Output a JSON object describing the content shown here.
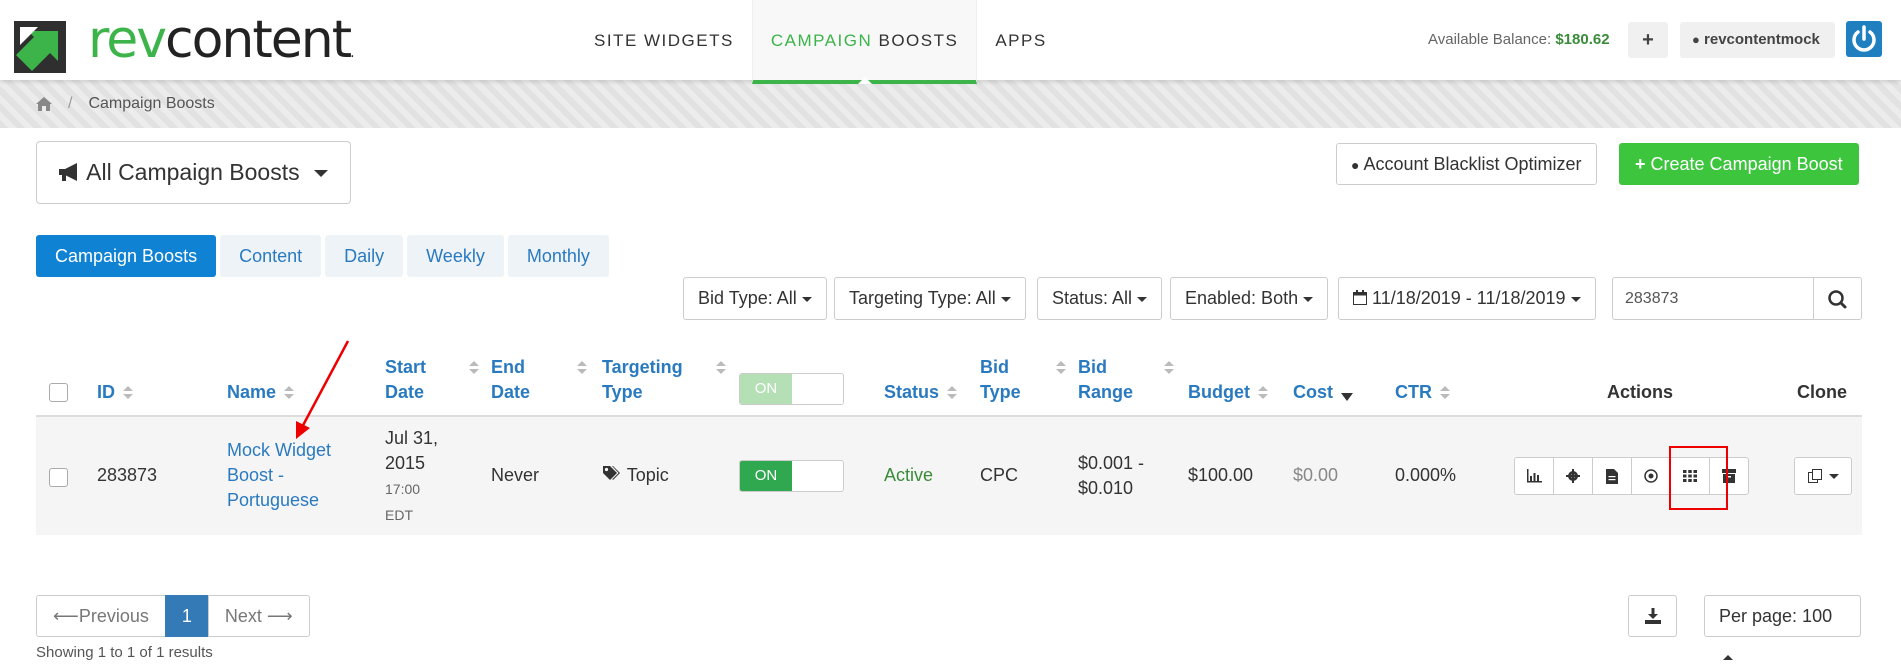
{
  "brand": {
    "logo_rev": "rev",
    "logo_content": "content",
    "logo_dot": "."
  },
  "nav": {
    "items": [
      {
        "label": "SITE WIDGETS"
      },
      {
        "label_accent": "CAMPAIGN",
        "label_rest": " BOOSTS",
        "active": true
      },
      {
        "label": "APPS"
      }
    ]
  },
  "account": {
    "balance_label": "Available Balance:",
    "balance_value": "$180.62",
    "add_label": "+",
    "username": "revcontentmock"
  },
  "breadcrumb": {
    "current": "Campaign Boosts",
    "separator": "/"
  },
  "selector": {
    "label": "All Campaign Boosts"
  },
  "buttons": {
    "blacklist": "Account Blacklist Optimizer",
    "create": "Create Campaign Boost"
  },
  "tabs": [
    "Campaign Boosts",
    "Content",
    "Daily",
    "Weekly",
    "Monthly"
  ],
  "filters": {
    "bid_type": "Bid Type: All",
    "targeting_type": "Targeting Type: All",
    "status": "Status: All",
    "enabled": "Enabled: Both",
    "date_range": "11/18/2019 - 11/18/2019",
    "search_value": "283873"
  },
  "table": {
    "headers": {
      "id": "ID",
      "name": "Name",
      "start_date_1": "Start",
      "start_date_2": "Date",
      "end_date_1": "End",
      "end_date_2": "Date",
      "targeting_1": "Targeting",
      "targeting_2": "Type",
      "toggle": "ON",
      "status": "Status",
      "bid_type_1": "Bid",
      "bid_type_2": "Type",
      "bid_range_1": "Bid",
      "bid_range_2": "Range",
      "budget": "Budget",
      "cost": "Cost",
      "ctr": "CTR",
      "actions": "Actions",
      "clone": "Clone"
    },
    "row": {
      "id": "283873",
      "name_1": "Mock Widget",
      "name_2": "Boost -",
      "name_3": "Portuguese",
      "start_1": "Jul 31,",
      "start_2": "2015",
      "start_3": "17:00",
      "start_4": "EDT",
      "end": "Never",
      "targeting": "Topic",
      "toggle": "ON",
      "status": "Active",
      "bid_type": "CPC",
      "bid_range_1": "$0.001 -",
      "bid_range_2": "$0.010",
      "budget": "$100.00",
      "cost": "$0.00",
      "ctr": "0.000%"
    }
  },
  "pagination": {
    "previous": "Previous",
    "page": "1",
    "next": "Next",
    "per_page": "Per page: 100",
    "results": "Showing 1 to 1 of 1 results"
  },
  "colors": {
    "brand_green": "#3cb44a",
    "link_blue": "#2a7ac0",
    "primary_blue": "#0f82d4",
    "toggle_green": "#2fa84f",
    "active_green": "#3a8c3a",
    "highlight_red": "#e00000"
  }
}
